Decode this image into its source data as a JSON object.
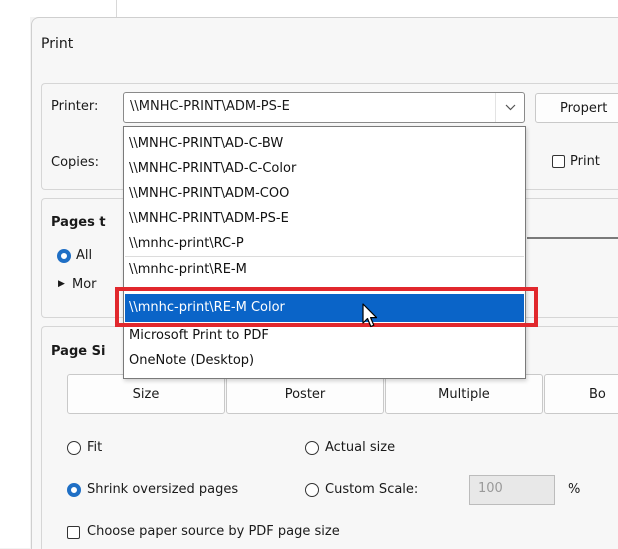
{
  "dialog": {
    "title": "Print"
  },
  "printer": {
    "label": "Printer:",
    "selected": "\\\\MNHC-PRINT\\ADM-PS-E",
    "properties_label": "Propert",
    "options": [
      "\\\\MNHC-PRINT\\AD-C-BW",
      "\\\\MNHC-PRINT\\AD-C-Color",
      "\\\\MNHC-PRINT\\ADM-COO",
      "\\\\MNHC-PRINT\\ADM-PS-E",
      "\\\\mnhc-print\\RC-P",
      "\\\\mnhc-print\\RE-M",
      "\\\\mnhc-print\\RE-M Color",
      "Microsoft Print to PDF",
      "OneNote (Desktop)"
    ],
    "highlighted_option": "\\\\mnhc-print\\RE-M Color"
  },
  "copies": {
    "label": "Copies:",
    "print_checkbox_label": "Print"
  },
  "pages": {
    "title_partial": "Pages t",
    "all_label": "All",
    "more_label": "Mor"
  },
  "page_size": {
    "title_partial": "Page Si",
    "tabs": [
      "Size",
      "Poster",
      "Multiple",
      "Bo"
    ],
    "fit_label": "Fit",
    "actual_size_label": "Actual size",
    "shrink_label": "Shrink oversized pages",
    "custom_scale_label": "Custom Scale:",
    "custom_scale_value": "100",
    "percent_label": "%",
    "paper_source_label": "Choose paper source by PDF page size"
  },
  "colors": {
    "accent": "#0a64c8",
    "highlight": "#e1282d"
  }
}
